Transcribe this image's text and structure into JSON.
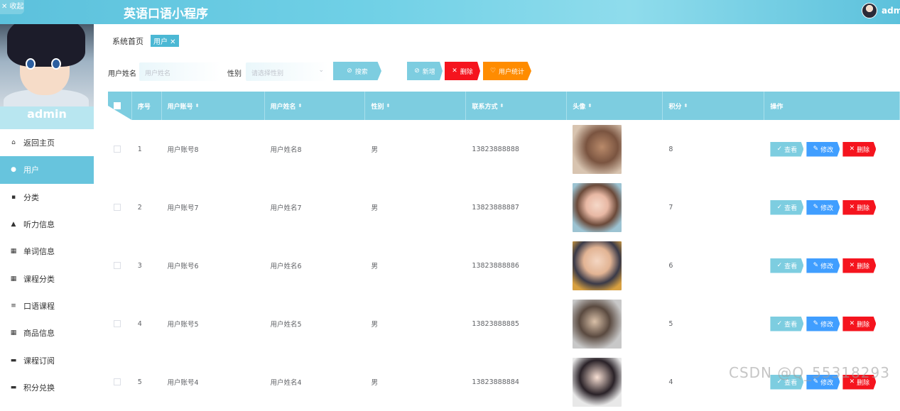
{
  "header": {
    "collapse_label": "✕ 收起",
    "title": "英语口语小程序",
    "user_name": "admin"
  },
  "sidebar": {
    "user_name": "admin",
    "items": [
      {
        "label": "返回主页",
        "icon": "home-icon",
        "glyph": "⌂"
      },
      {
        "label": "用户",
        "icon": "user-pin-icon",
        "glyph": "●"
      },
      {
        "label": "分类",
        "icon": "clipboard-icon",
        "glyph": "▪"
      },
      {
        "label": "听力信息",
        "icon": "person-icon",
        "glyph": "▲"
      },
      {
        "label": "单词信息",
        "icon": "grid-icon",
        "glyph": "▦"
      },
      {
        "label": "课程分类",
        "icon": "grid-icon",
        "glyph": "▦"
      },
      {
        "label": "口语课程",
        "icon": "list-icon",
        "glyph": "≡"
      },
      {
        "label": "商品信息",
        "icon": "grid-icon",
        "glyph": "▦"
      },
      {
        "label": "课程订阅",
        "icon": "doc-icon",
        "glyph": "▬"
      },
      {
        "label": "积分兑换",
        "icon": "doc-icon",
        "glyph": "▬"
      }
    ],
    "active_index": 1
  },
  "breadcrumb": {
    "home": "系统首页",
    "current": "用户 ✕"
  },
  "search": {
    "name_label": "用户姓名",
    "name_placeholder": "用户姓名",
    "gender_label": "性别",
    "gender_placeholder": "请选择性别",
    "search_button": "搜索",
    "add_button": "新增",
    "delete_button": "删除",
    "stats_button": "用户统计"
  },
  "table": {
    "columns": [
      "序号",
      "用户账号",
      "用户姓名",
      "性别",
      "联系方式",
      "头像",
      "积分",
      "操作"
    ],
    "rows": [
      {
        "idx": "1",
        "account": "用户账号8",
        "name": "用户姓名8",
        "gender": "男",
        "phone": "13823888888",
        "points": "8"
      },
      {
        "idx": "2",
        "account": "用户账号7",
        "name": "用户姓名7",
        "gender": "男",
        "phone": "13823888887",
        "points": "7"
      },
      {
        "idx": "3",
        "account": "用户账号6",
        "name": "用户姓名6",
        "gender": "男",
        "phone": "13823888886",
        "points": "6"
      },
      {
        "idx": "4",
        "account": "用户账号5",
        "name": "用户姓名5",
        "gender": "男",
        "phone": "13823888885",
        "points": "5"
      },
      {
        "idx": "5",
        "account": "用户账号4",
        "name": "用户姓名4",
        "gender": "男",
        "phone": "13823888884",
        "points": "4"
      }
    ],
    "actions": {
      "view": "查看",
      "edit": "修改",
      "delete": "删除"
    }
  },
  "colors": {
    "accent": "#67c4dd",
    "view_btn": "#7dcde0",
    "edit_btn": "#409eff",
    "delete_btn": "#f5141e",
    "stats_btn": "#ff8c00"
  },
  "watermark": "CSDN @Q_55318293"
}
